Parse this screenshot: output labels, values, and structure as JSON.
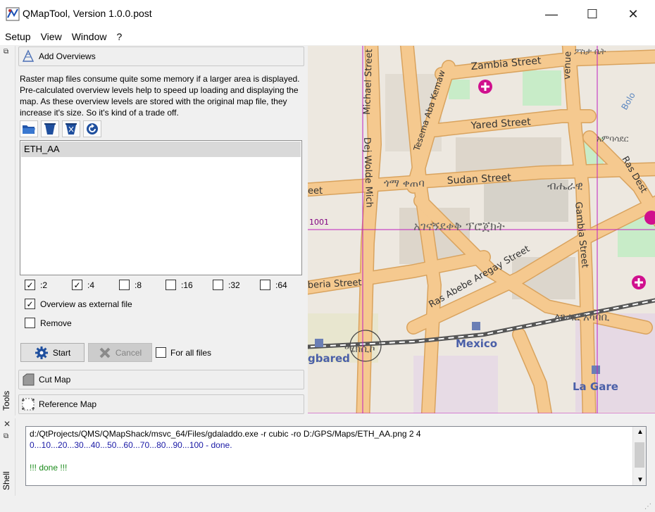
{
  "window": {
    "title": "QMapTool, Version 1.0.0.post",
    "minimize_glyph": "—",
    "maximize_glyph": "☐",
    "close_glyph": "✕"
  },
  "menu": [
    "Setup",
    "View",
    "Window",
    "?"
  ],
  "tools_panel": {
    "rail_label": "Tools",
    "overviews": {
      "header": "Add Overviews",
      "description": "Raster map files consume quite some memory if a larger area is displayed. Pre-calculated overview levels help to speed up loading and displaying the map. As these overview levels are stored with the original map file, they increase it's size. So it's kind of a trade off.",
      "files": [
        "ETH_AA"
      ],
      "levels": [
        {
          "label": ":2",
          "checked": true
        },
        {
          "label": ":4",
          "checked": true
        },
        {
          "label": ":8",
          "checked": false
        },
        {
          "label": ":16",
          "checked": false
        },
        {
          "label": ":32",
          "checked": false
        },
        {
          "label": ":64",
          "checked": false
        }
      ],
      "external_file_label": "Overview as external file",
      "external_file_checked": true,
      "remove_label": "Remove",
      "remove_checked": false,
      "start_label": "Start",
      "cancel_label": "Cancel",
      "all_files_label": "For all files"
    },
    "cut_map_label": "Cut Map",
    "reference_map_label": "Reference Map"
  },
  "map": {
    "grid_label": "1001",
    "streets": {
      "zambia": "Zambia Street",
      "yared": "Yared Street",
      "sudan": "Sudan Street",
      "ras_abebe": "Ras Abebe Aregay Street",
      "gambia": "Gambia Street",
      "tesema": "Tesema Aba Kemaw",
      "michael": "Michael Street",
      "dej": "Dej Wolde Mich",
      "venue": "venue",
      "ras_des": "Ras Dest",
      "beria": "beria Street",
      "eet": "eet"
    },
    "amharic": {
      "sudan": "ጎማ ቀጠባ",
      "projects": "አገናኝደቀቅ ፕሮጀክት",
      "bihere": "ብሔራዊ",
      "lideta": "ለገሓር አካባቢ",
      "megenagna": "ሜክሲኮ",
      "amba": "አምባሳደር",
      "top": "ፖስታ ቤት"
    },
    "places": {
      "mexico": "Mexico",
      "la_gare": "La Gare",
      "gbared": "gbared",
      "bolo": "Bolo"
    }
  },
  "shell": {
    "rail_label": "Shell",
    "lines": [
      {
        "text": "d:/QtProjects/QMS/QMapShack/msvc_64/Files/gdaladdo.exe -r cubic -ro D:/GPS/Maps/ETH_AA.png 2 4",
        "color": "#000000"
      },
      {
        "text": "0...10...20...30...40...50...60...70...80...90...100 - done.",
        "color": "#1a1aa6"
      },
      {
        "text": "",
        "color": "#000000"
      },
      {
        "text": "!!! done !!!",
        "color": "#1a8a1a"
      }
    ]
  },
  "colors": {
    "road": "#f5c98f",
    "road_outline": "#d9a35e",
    "grid": "#c020c0",
    "park": "#c8ecc8",
    "rail": "#555555",
    "station": "#6b7fb5"
  }
}
